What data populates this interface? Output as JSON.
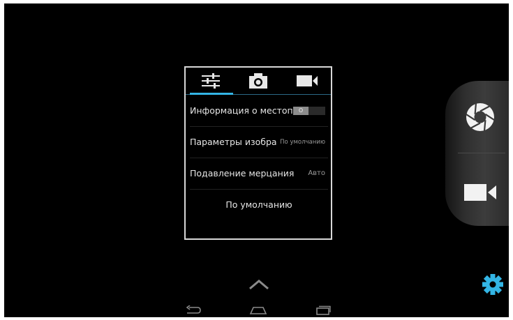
{
  "settings_popup": {
    "tabs": [
      {
        "name": "settings-tab",
        "icon": "sliders-icon",
        "active": true
      },
      {
        "name": "camera-tab",
        "icon": "camera-icon",
        "active": false
      },
      {
        "name": "video-tab",
        "icon": "video-camera-icon",
        "active": false
      }
    ],
    "rows": [
      {
        "label": "Информация о местопо",
        "control": "toggle",
        "toggle_text": "O",
        "state": "off"
      },
      {
        "label": "Параметры изобра",
        "value": "По умолчанию"
      },
      {
        "label": "Подавление мерцания",
        "value": "Авто"
      }
    ],
    "default_button": "По умолчанию"
  },
  "right_panel": {
    "shutter_icon": "shutter-aperture-icon",
    "video_icon": "video-camera-icon"
  },
  "settings_gear_icon": "gear-icon",
  "accent_color": "#33b5e5",
  "nav_bar": {
    "back": "back-icon",
    "home": "home-icon",
    "recents": "recents-icon",
    "expand": "chevron-up-icon"
  }
}
